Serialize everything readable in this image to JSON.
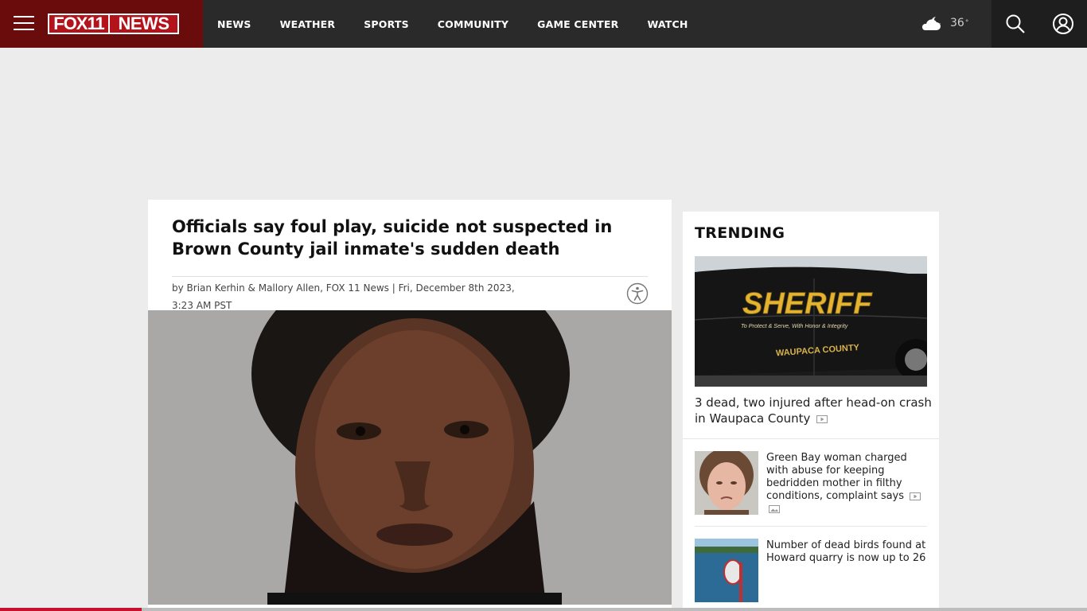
{
  "header": {
    "logo": {
      "part1": "FOX11",
      "part2": "NEWS"
    },
    "nav": [
      "NEWS",
      "WEATHER",
      "SPORTS",
      "COMMUNITY",
      "GAME CENTER",
      "WATCH"
    ],
    "weather": {
      "temp": "36",
      "unit": "°",
      "icon": "cloudy-night-icon"
    },
    "icons": [
      "menu-icon",
      "search-icon",
      "user-icon"
    ]
  },
  "article": {
    "headline": "Officials say foul play, suicide not suspected in Brown County jail inmate's sudden death",
    "byline": "by Brian Kerhin & Mallory Allen, FOX 11 News | Fri, December 8th 2023, 3:23 AM PST",
    "accessibility_icon": "accessibility-icon"
  },
  "trending": {
    "title": "TRENDING",
    "featured": {
      "title": "3 dead, two injured after head-on crash in Waupaca County",
      "image_text": {
        "line1": "SHERIFF",
        "line2": "To Protect & Serve, With Honor & Integrity",
        "line3": "WAUPACA COUNTY"
      },
      "media_icon": "video-icon"
    },
    "items": [
      {
        "title": "Green Bay woman charged with abuse for keeping bedridden mother in filthy conditions, complaint says",
        "media_icons": [
          "video-icon",
          "gallery-icon"
        ]
      },
      {
        "title": "Number of dead birds found at Howard quarry is now up to 26",
        "media_icons": []
      }
    ]
  },
  "colors": {
    "header_bg": "#2a2a2a",
    "brand_bg": "#6b0c0c",
    "accent": "#b3141b",
    "page_bg": "#ececec"
  },
  "scroll_progress": 0.13
}
